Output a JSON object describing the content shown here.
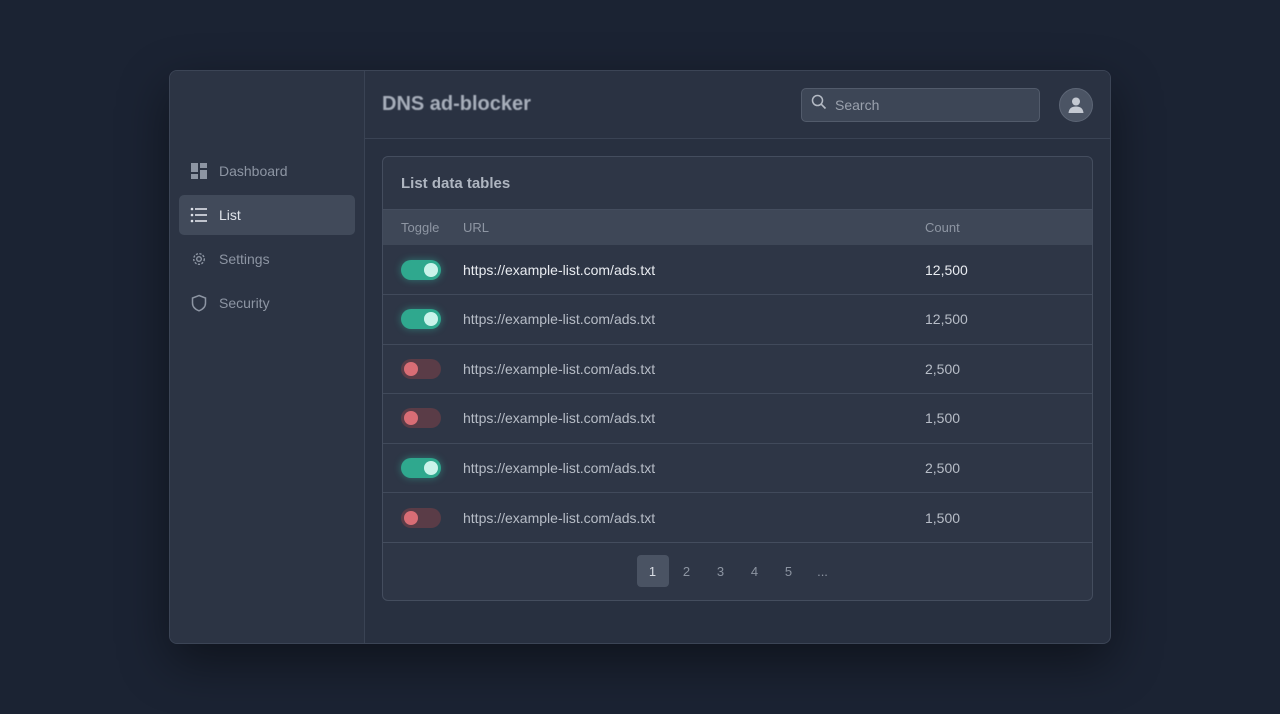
{
  "app": {
    "title": "DNS ad-blocker"
  },
  "search": {
    "placeholder": "Search",
    "value": ""
  },
  "sidebar": {
    "items": [
      {
        "label": "Dashboard",
        "icon": "dashboard-icon"
      },
      {
        "label": "List",
        "icon": "list-icon",
        "active": true
      },
      {
        "label": "Settings",
        "icon": "gear-icon"
      },
      {
        "label": "Security",
        "icon": "shield-icon"
      }
    ]
  },
  "card": {
    "title": "List data tables",
    "columns": [
      "Toggle",
      "URL",
      "Count"
    ],
    "rows": [
      {
        "enabled": true,
        "url": "https://example-list.com/ads.txt",
        "count": "12,500"
      },
      {
        "enabled": true,
        "url": "https://example-list.com/ads.txt",
        "count": "12,500"
      },
      {
        "enabled": false,
        "url": "https://example-list.com/ads.txt",
        "count": "2,500"
      },
      {
        "enabled": false,
        "url": "https://example-list.com/ads.txt",
        "count": "1,500"
      },
      {
        "enabled": true,
        "url": "https://example-list.com/ads.txt",
        "count": "2,500"
      },
      {
        "enabled": false,
        "url": "https://example-list.com/ads.txt",
        "count": "1,500"
      }
    ]
  },
  "pagination": {
    "pages": [
      "1",
      "2",
      "3",
      "4",
      "5",
      "..."
    ],
    "current": "1"
  },
  "colors": {
    "toggle_on": "#2fa88e",
    "toggle_off": "#d86d75",
    "background": "#1b2333"
  }
}
